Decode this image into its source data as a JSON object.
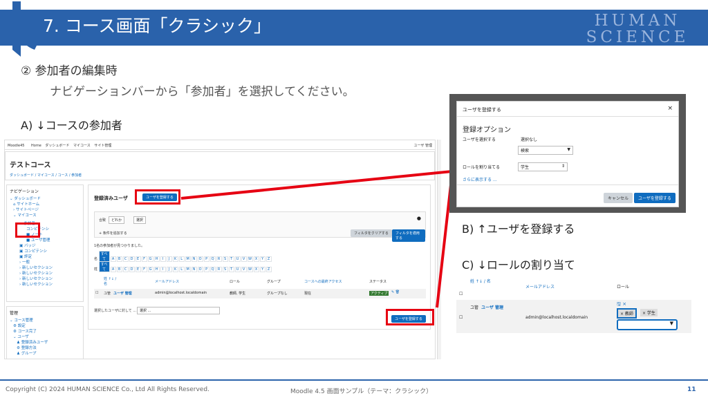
{
  "slide": {
    "title": "7. コース画面「クラシック」",
    "logo_text": [
      "HUMAN",
      "SCIENCE"
    ],
    "subtitle": "② 参加者の編集時",
    "instruction": "ナビゲーションバーから「参加者」を選択してください。",
    "label_a": "A) ↓コースの参加者",
    "label_b": "B) ↑ユーザを登録する",
    "label_c": "C) ↓ロールの割り当て",
    "footer_copyright": "Copyright (C) 2024 HUMAN SCIENCE Co., Ltd All Rights Reserved.",
    "footer_center": "Moodle 4.5 画面サンプル（テーマ：クラシック）",
    "page_number": "11"
  },
  "shot_a": {
    "topbar": {
      "brand": "Moodle45",
      "menu": [
        "Home",
        "ダッシュボード",
        "マイコース",
        "サイト管理"
      ],
      "user": "ユーザ 管理"
    },
    "course_title": "テストコース",
    "breadcrumb": "ダッシュボード / マイコース / コース / 参加者",
    "nav": {
      "heading": "ナビゲーション",
      "items": [
        "ダッシュボード",
        "サイトホーム",
        "サイトページ",
        "マイコース",
        "参加者",
        "コンピテンシ",
        "ノート",
        "ユーザ管理",
        "バッジ",
        "コンピテンシ",
        "評定",
        "一般",
        "新しいセクション",
        "新しいセクション",
        "新しいセクション",
        "新しいセクション"
      ]
    },
    "admin": {
      "heading": "管理",
      "items": [
        "コース管理",
        "設定",
        "コース完了",
        "ユーザ",
        "登録済みユーザ",
        "登録方法",
        "グループ"
      ]
    },
    "enrolled_title": "登録済みユーザ",
    "enrol_button": "ユーザを登録する",
    "filter": {
      "match": "合致",
      "any": "どれか",
      "select": "選択",
      "add": "条件を追加する",
      "clear": "フィルタをクリアする",
      "apply": "フィルタを適用する"
    },
    "found": "1名の参加者が見つかりました。",
    "first": "名",
    "last": "姓",
    "all": "すべて",
    "letters": [
      "A",
      "B",
      "C",
      "D",
      "E",
      "F",
      "G",
      "H",
      "I",
      "J",
      "K",
      "L",
      "M",
      "N",
      "O",
      "P",
      "Q",
      "R",
      "S",
      "T",
      "U",
      "V",
      "W",
      "X",
      "Y",
      "Z"
    ],
    "columns": [
      "姓 ↑↓ / 名",
      "メールアドレス",
      "ロール",
      "グループ",
      "コースへの最終アクセス",
      "ステータス"
    ],
    "row": {
      "avatar": "ユ管",
      "name": "ユーザ 管理",
      "email": "admin@localhost.localdomain",
      "roles": "教師, 学生",
      "groups": "グループなし",
      "access": "現在",
      "status": "アクティブ"
    },
    "with_selected": "選択したユーザに対して ...",
    "choose": "選択 ..."
  },
  "shot_b": {
    "title": "ユーザを登録する",
    "section": "登録オプション",
    "select_users_label": "ユーザを選択する",
    "no_selection": "選択なし",
    "search": "検索",
    "role_label": "ロールを割り当てる",
    "role_value": "学生",
    "show_more": "さらに表示する ...",
    "cancel": "キャンセル",
    "submit": "ユーザを登録する"
  },
  "shot_c": {
    "col_name": "姓 ↑↓ / 名",
    "col_email": "メールアドレス",
    "col_role": "ロール",
    "avatar": "ユ管",
    "name": "ユーザ 管理",
    "email": "admin@localhost.localdomain",
    "roles": [
      "× 教師",
      "× 学生"
    ]
  }
}
